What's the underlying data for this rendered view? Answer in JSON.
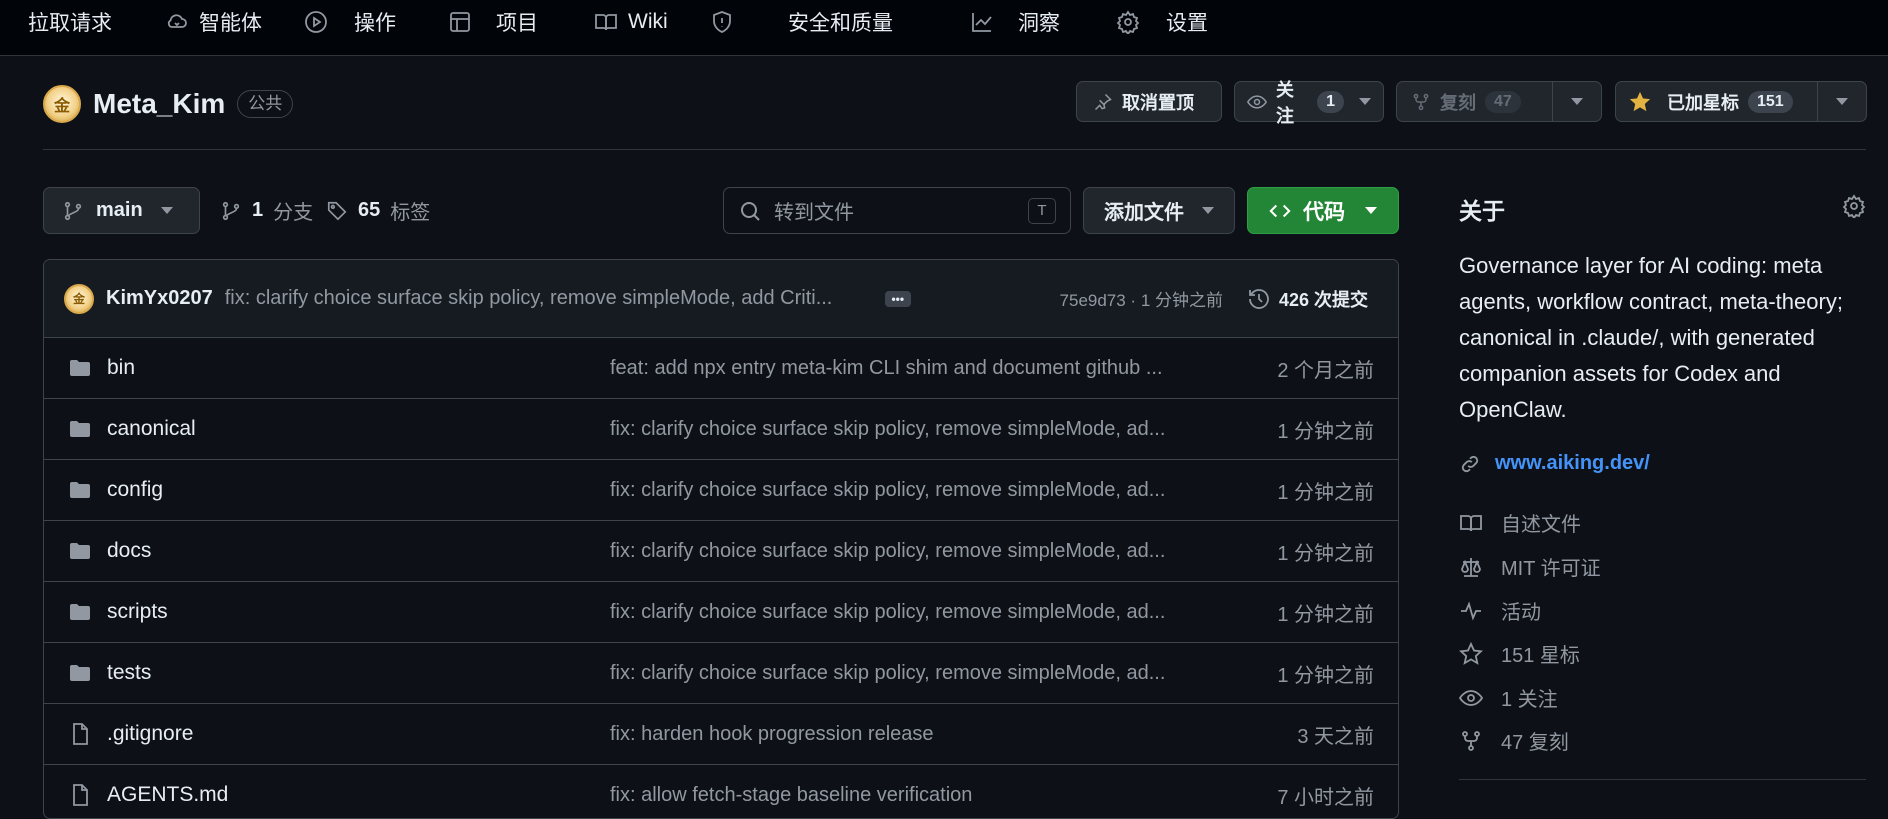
{
  "nav": {
    "items": [
      {
        "label": "拉取请求",
        "icon": "none"
      },
      {
        "label": "智能体",
        "icon": "agent-cloud-icon"
      },
      {
        "label": "操作",
        "icon": "play-icon"
      },
      {
        "label": "项目",
        "icon": "table-icon"
      },
      {
        "label": "Wiki",
        "icon": "book-icon"
      },
      {
        "label": "安全和质量",
        "icon": "shield-icon"
      },
      {
        "label": "洞察",
        "icon": "graph-icon"
      },
      {
        "label": "设置",
        "icon": "gear-icon"
      }
    ]
  },
  "repo": {
    "name": "Meta_Kim",
    "visibility": "公共",
    "avatar_glyph": "金"
  },
  "header_buttons": {
    "unpin": "取消置顶",
    "watch": "关注",
    "watch_count": "1",
    "fork": "复刻",
    "fork_count": "47",
    "star": "已加星标",
    "star_count": "151"
  },
  "toolbar": {
    "branch": "main",
    "branches_count": "1",
    "branches_label": "分支",
    "tags_count": "65",
    "tags_label": "标签",
    "search_placeholder": "转到文件",
    "search_key": "T",
    "add_file": "添加文件",
    "code": "代码"
  },
  "latest_commit": {
    "author": "KimYx0207",
    "message": "fix: clarify choice surface skip policy, remove simpleMode, add Criti...",
    "ellipsis": "•••",
    "hash_time": "75e9d73 · 1 分钟之前",
    "count": "426 次提交"
  },
  "files": [
    {
      "name": "bin",
      "type": "folder",
      "message": "feat: add npx entry meta-kim CLI shim and document github ...",
      "time": "2 个月之前"
    },
    {
      "name": "canonical",
      "type": "folder",
      "message": "fix: clarify choice surface skip policy, remove simpleMode, ad...",
      "time": "1 分钟之前"
    },
    {
      "name": "config",
      "type": "folder",
      "message": "fix: clarify choice surface skip policy, remove simpleMode, ad...",
      "time": "1 分钟之前"
    },
    {
      "name": "docs",
      "type": "folder",
      "message": "fix: clarify choice surface skip policy, remove simpleMode, ad...",
      "time": "1 分钟之前"
    },
    {
      "name": "scripts",
      "type": "folder",
      "message": "fix: clarify choice surface skip policy, remove simpleMode, ad...",
      "time": "1 分钟之前"
    },
    {
      "name": "tests",
      "type": "folder",
      "message": "fix: clarify choice surface skip policy, remove simpleMode, ad...",
      "time": "1 分钟之前"
    },
    {
      "name": ".gitignore",
      "type": "file",
      "message": "fix: harden hook progression release",
      "time": "3 天之前"
    },
    {
      "name": "AGENTS.md",
      "type": "file",
      "message": "fix: allow fetch-stage baseline verification",
      "time": "7 小时之前"
    }
  ],
  "about": {
    "title": "关于",
    "description": "Governance layer for AI coding: meta agents, workflow contract, meta-theory; canonical in .claude/, with generated companion assets for Codex and OpenClaw.",
    "link": "www.aiking.dev/",
    "items": [
      {
        "label": "自述文件",
        "icon": "book-icon"
      },
      {
        "label": "MIT 许可证",
        "icon": "law-scale-icon"
      },
      {
        "label": "活动",
        "icon": "pulse-icon"
      },
      {
        "label": "151 星标",
        "icon": "star-icon"
      },
      {
        "label": "1 关注",
        "icon": "eye-icon"
      },
      {
        "label": "47 复刻",
        "icon": "fork-icon"
      }
    ]
  },
  "colors": {
    "background": "#0d1117",
    "accent_green": "#238636",
    "link_blue": "#4493f8",
    "star_yellow": "#e3b341",
    "folder_gray": "#9198a1"
  }
}
